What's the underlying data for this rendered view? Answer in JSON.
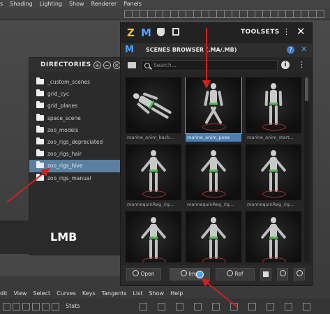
{
  "menubar": {
    "items": [
      "s",
      "Shading",
      "Lighting",
      "Show",
      "Renderer",
      "Panels"
    ]
  },
  "directories": {
    "title": "DIRECTORIES",
    "header_buttons": [
      "+",
      "−",
      "×"
    ],
    "items": [
      {
        "label": "_custom_scenes",
        "selected": false
      },
      {
        "label": "grid_cyc",
        "selected": false
      },
      {
        "label": "grid_planes",
        "selected": false
      },
      {
        "label": "space_scene",
        "selected": false
      },
      {
        "label": "zoo_models",
        "selected": false
      },
      {
        "label": "zoo_rigs_depreciated",
        "selected": false
      },
      {
        "label": "zoo_rigs_hair",
        "selected": false
      },
      {
        "label": "zoo_rigs_hive",
        "selected": true
      },
      {
        "label": "zoo_rigs_manual",
        "selected": false
      }
    ]
  },
  "overlay": {
    "lmb_label": "LMB"
  },
  "browser": {
    "toolbar": {
      "z_icon": "Z",
      "m_icon": "M",
      "toolsets_label": "TOOLSETS",
      "more": "⋮",
      "close": "✕"
    },
    "subheader": {
      "m_icon": "M",
      "title": "SCENES BROWSER (.MA/.MB)",
      "help": "?",
      "close": "✕"
    },
    "search": {
      "placeholder": "Search...",
      "info": "i",
      "more": "⋮"
    },
    "thumbnails": [
      {
        "caption": "marine_anim_back...",
        "selected": false,
        "pose": "cartwheel"
      },
      {
        "caption": "marine_anim_pose",
        "selected": true,
        "pose": "lunge"
      },
      {
        "caption": "marine_anim_start...",
        "selected": false,
        "pose": "stand"
      },
      {
        "caption": "mannequinReg_rig...",
        "selected": false,
        "pose": "tpose"
      },
      {
        "caption": "mannequinReg_rig...",
        "selected": false,
        "pose": "tpose"
      },
      {
        "caption": "mannequinReg_rig...",
        "selected": false,
        "pose": "tpose"
      },
      {
        "caption": "",
        "selected": false,
        "pose": "tpose"
      },
      {
        "caption": "",
        "selected": false,
        "pose": "tpose"
      },
      {
        "caption": "",
        "selected": false,
        "pose": "tpose"
      }
    ],
    "buttons": {
      "open": "Open",
      "import": "Imp",
      "ref": "Ref"
    }
  },
  "bottom_menu": {
    "items": [
      "dit",
      "View",
      "Select",
      "Curves",
      "Keys",
      "Tangents",
      "List",
      "Show",
      "Help"
    ]
  },
  "bottom_toolbar": {
    "stats_label": "Stats"
  },
  "colors": {
    "accent_blue": "#4aa3ff",
    "selection": "#5a7fa0",
    "annotation_red": "#d02020",
    "belt_green": "#4ec04e"
  }
}
